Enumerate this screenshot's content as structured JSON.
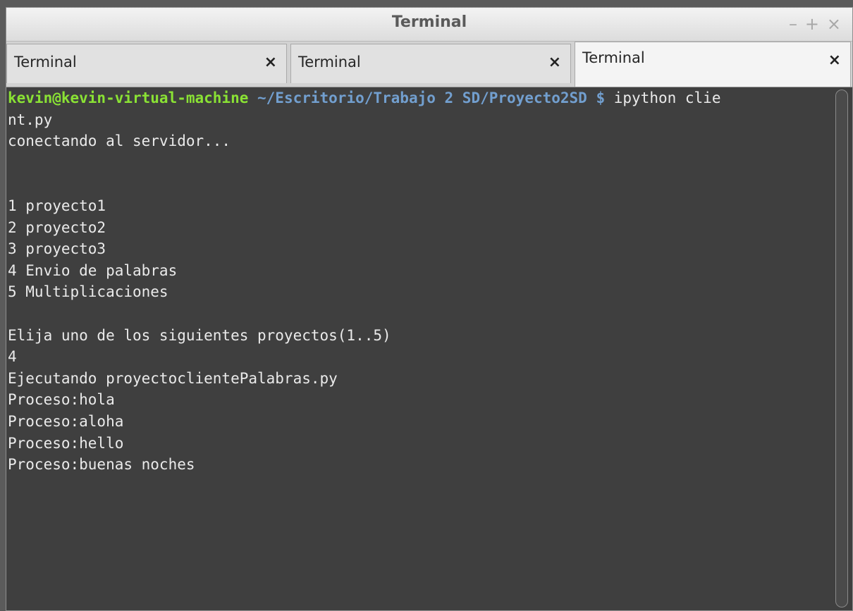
{
  "window": {
    "title": "Terminal",
    "controls": {
      "minimize": "–",
      "maximize": "+",
      "close": "×"
    }
  },
  "tabs": [
    {
      "label": "Terminal",
      "close": "×",
      "active": false
    },
    {
      "label": "Terminal",
      "close": "×",
      "active": false
    },
    {
      "label": "Terminal",
      "close": "×",
      "active": true
    }
  ],
  "terminal": {
    "prompt": {
      "user_host": "kevin@kevin-virtual-machine",
      "path": " ~/Escritorio/Trabajo 2 SD/Proyecto2SD",
      "sign": " $",
      "command": " ipython clie"
    },
    "lines": [
      "nt.py",
      "conectando al servidor...",
      "",
      "",
      "1 proyecto1",
      "2 proyecto2",
      "3 proyecto3",
      "4 Envio de palabras",
      "5 Multiplicaciones",
      "",
      "Elija uno de los siguientes proyectos(1..5)",
      "4",
      "Ejecutando proyectoclientePalabras.py",
      "Proceso:hola",
      "Proceso:aloha",
      "Proceso:hello",
      "Proceso:buenas noches"
    ]
  },
  "colors": {
    "terminal_bg": "#3f3f3f",
    "terminal_fg": "#eaeaea",
    "prompt_user": "#8ae234",
    "prompt_path": "#729fcf"
  }
}
